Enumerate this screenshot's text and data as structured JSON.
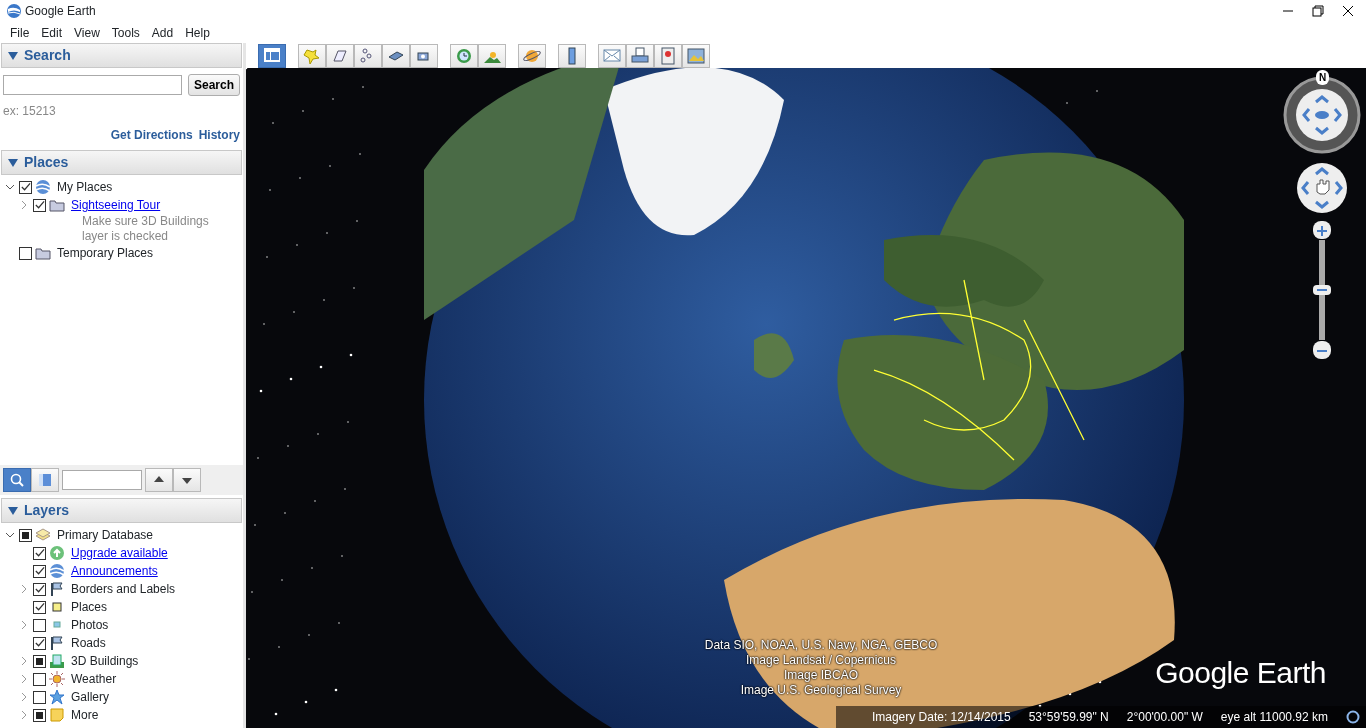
{
  "window": {
    "title": "Google Earth"
  },
  "menu": [
    "File",
    "Edit",
    "View",
    "Tools",
    "Add",
    "Help"
  ],
  "search": {
    "title": "Search",
    "expanded": true,
    "button": "Search",
    "hint": "ex: 15213",
    "links": [
      "Get Directions",
      "History"
    ]
  },
  "places": {
    "title": "Places",
    "expanded": true,
    "items": [
      {
        "label": "My Places",
        "kind": "globe",
        "checked": true,
        "partial": false,
        "expanded": true,
        "children": [
          {
            "label": "Sightseeing Tour",
            "kind": "folder",
            "checked": true,
            "partial": false,
            "expanded": false,
            "link": true,
            "description": "Make sure 3D Buildings layer is checked"
          }
        ]
      },
      {
        "label": "Temporary Places",
        "kind": "folder",
        "checked": false,
        "partial": false
      }
    ]
  },
  "places_toolbar": {
    "buttons": [
      {
        "kind": "search",
        "selected": true
      },
      {
        "kind": "panel",
        "selected": false
      }
    ]
  },
  "layers": {
    "title": "Layers",
    "expanded": true,
    "items": [
      {
        "label": "Primary Database",
        "kind": "layers",
        "checked": false,
        "partial": true,
        "expanded": true,
        "children": [
          {
            "label": "Upgrade available",
            "kind": "upgrade",
            "checked": true,
            "partial": false,
            "link": true
          },
          {
            "label": "Announcements",
            "kind": "globe",
            "checked": true,
            "partial": false,
            "link": true
          },
          {
            "label": "Borders and Labels",
            "kind": "flag",
            "checked": true,
            "partial": false,
            "expanded": false
          },
          {
            "label": "Places",
            "kind": "place",
            "checked": true,
            "partial": false
          },
          {
            "label": "Photos",
            "kind": "photo",
            "checked": false,
            "partial": false,
            "expanded": false
          },
          {
            "label": "Roads",
            "kind": "flag",
            "checked": true,
            "partial": false
          },
          {
            "label": "3D Buildings",
            "kind": "buildings",
            "checked": false,
            "partial": true,
            "expanded": false
          },
          {
            "label": "Weather",
            "kind": "weather",
            "checked": false,
            "partial": false,
            "expanded": false
          },
          {
            "label": "Gallery",
            "kind": "star",
            "checked": false,
            "partial": false,
            "expanded": false
          },
          {
            "label": "More",
            "kind": "note",
            "checked": false,
            "partial": true,
            "expanded": false
          }
        ]
      }
    ]
  },
  "toolbar": [
    [
      {
        "kind": "sidebar",
        "selected": true
      }
    ],
    [
      {
        "kind": "placemark",
        "selected": false
      },
      {
        "kind": "polygon",
        "selected": false
      },
      {
        "kind": "path",
        "selected": false
      },
      {
        "kind": "overlay",
        "selected": false
      },
      {
        "kind": "tour",
        "selected": false
      }
    ],
    [
      {
        "kind": "history",
        "selected": false
      },
      {
        "kind": "sun",
        "selected": false
      }
    ],
    [
      {
        "kind": "planet",
        "selected": false
      }
    ],
    [
      {
        "kind": "ruler",
        "selected": false
      }
    ],
    [
      {
        "kind": "email",
        "selected": false
      },
      {
        "kind": "print",
        "selected": false
      },
      {
        "kind": "maps",
        "selected": false
      },
      {
        "kind": "image",
        "selected": false
      }
    ]
  ],
  "map": {
    "attribution": [
      "Data SIO, NOAA, U.S. Navy, NGA, GEBCO",
      "Image Landsat / Copernicus",
      "Image IBCAO",
      "Image U.S. Geological Survey"
    ],
    "logo": "Google Earth",
    "status": {
      "imagery_date": "Imagery Date: 12/14/2015",
      "latitude": "53°59'59.99\" N",
      "longitude": "2°00'00.00\" W",
      "eye_alt": "eye alt 11000.92 km"
    },
    "compass": {
      "north": "N"
    },
    "zoom": {
      "level": 0.5
    }
  }
}
